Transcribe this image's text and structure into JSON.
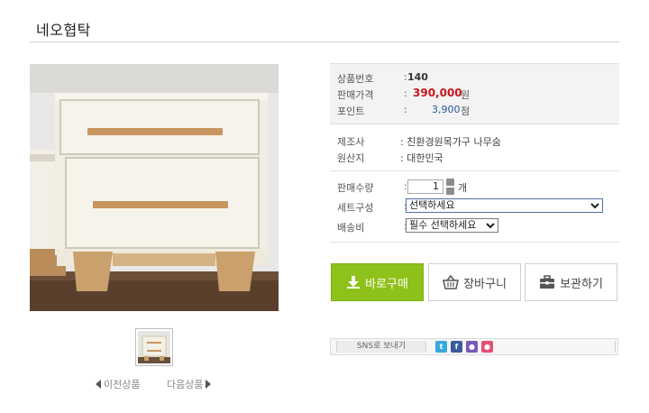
{
  "page": {
    "title": "네오협탁"
  },
  "gallery": {
    "prev_label": "이전상품",
    "next_label": "다음상품"
  },
  "product": {
    "code_label": "상품번호",
    "code_value": "140",
    "price_label": "판매가격",
    "price_value": "390,000",
    "price_unit": "원",
    "point_label": "포인트",
    "point_value": "3,900",
    "point_unit": "점",
    "maker_label": "제조사",
    "maker_value": ": 친환경원목가구 나무숨",
    "origin_label": "원산지",
    "origin_value": ": 대한민국",
    "qty_label": "판매수량",
    "qty_value": "1",
    "qty_unit": "개",
    "set_label": "세트구성",
    "set_selected": "선택하세요",
    "ship_label": "배송비",
    "ship_selected": "필수 선택하세요",
    "colon": ":"
  },
  "buttons": {
    "buy": "바로구매",
    "cart": "장바구니",
    "keep": "보관하기"
  },
  "sns": {
    "label": "SNS로 보내기",
    "icons": [
      "twitter-icon",
      "facebook-icon",
      "me2day-icon",
      "kakaostory-icon"
    ]
  },
  "colors": {
    "price": "#c8161d",
    "point": "#2a5a9b",
    "buy_button": "#8ec119"
  }
}
